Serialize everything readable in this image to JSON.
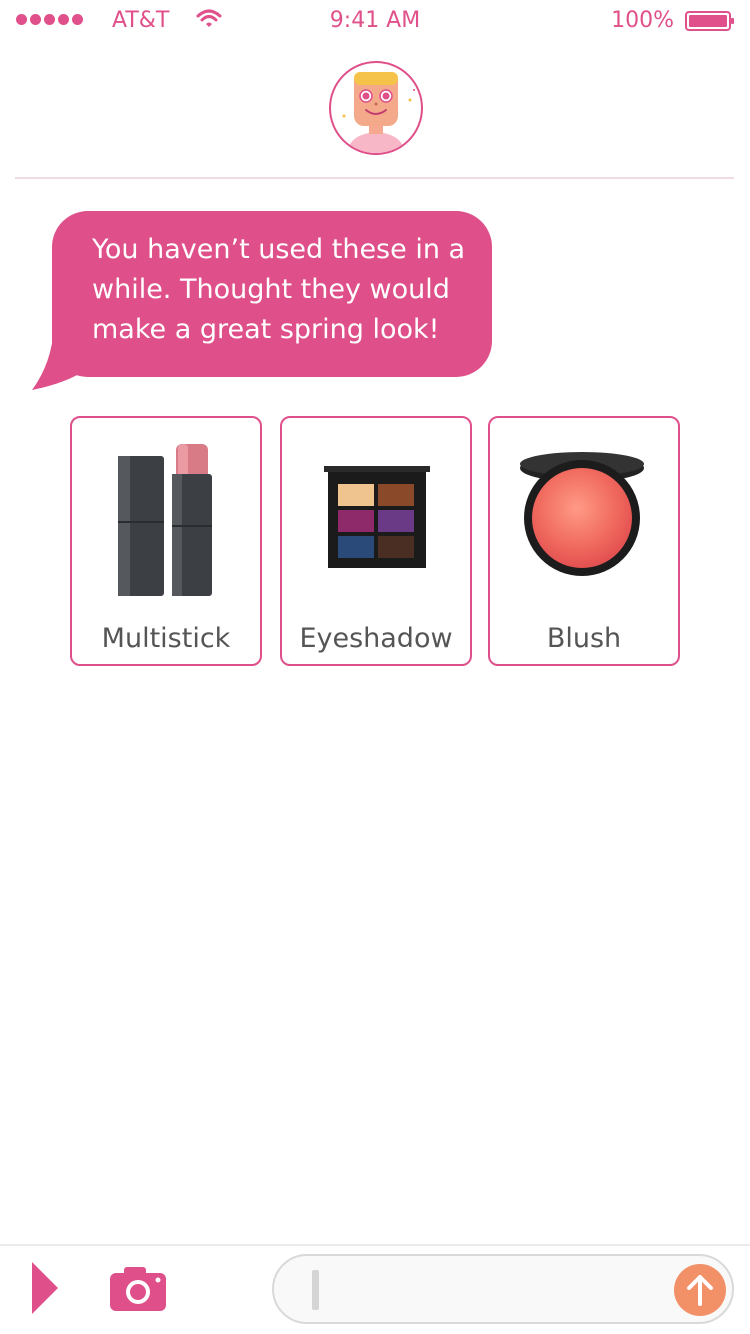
{
  "status_bar": {
    "carrier": "AT&T",
    "time": "9:41 AM",
    "battery": "100%",
    "accent_color": "#e0508a"
  },
  "header": {
    "avatar_icon": "robot-girl-avatar-icon"
  },
  "message": {
    "text": "You haven’t used these in a while. Thought they would make a great spring look!",
    "bubble_color": "#df4f89"
  },
  "products": [
    {
      "label": "Multistick",
      "image": "lipstick-image"
    },
    {
      "label": "Eyeshadow",
      "image": "eyeshadow-palette-image"
    },
    {
      "label": "Blush",
      "image": "blush-compact-image"
    }
  ],
  "compose": {
    "input_value": "",
    "play_icon": "play-icon",
    "camera_icon": "camera-icon",
    "send_icon": "arrow-up-icon",
    "send_color": "#f29167"
  }
}
